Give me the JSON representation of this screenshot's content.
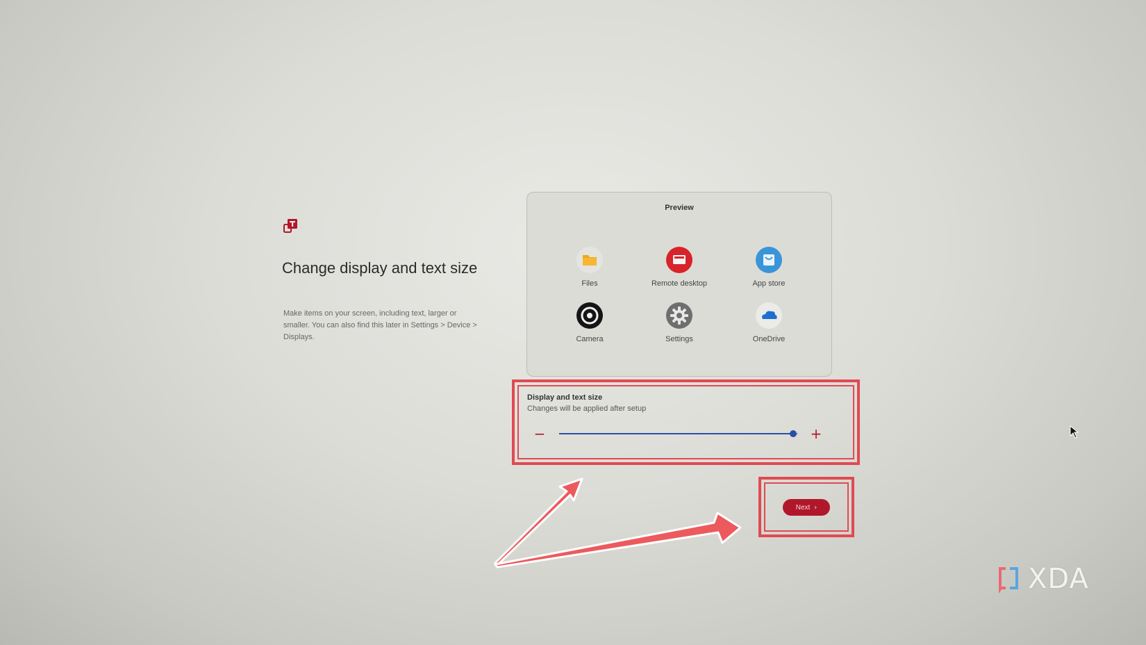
{
  "setup": {
    "heading": "Change display and text size",
    "description": "Make items on your screen, including text, larger or smaller. You can also find this later in Settings > Device > Displays."
  },
  "preview": {
    "title": "Preview",
    "apps": [
      {
        "label": "Files",
        "icon": "folder-icon"
      },
      {
        "label": "Remote desktop",
        "icon": "remote-desktop-icon"
      },
      {
        "label": "App store",
        "icon": "app-store-icon"
      },
      {
        "label": "Camera",
        "icon": "camera-icon"
      },
      {
        "label": "Settings",
        "icon": "gear-icon"
      },
      {
        "label": "OneDrive",
        "icon": "cloud-icon"
      }
    ]
  },
  "display_size": {
    "title": "Display and text size",
    "subtitle": "Changes will be applied after setup",
    "minus_label": "−",
    "plus_label": "+",
    "slider_value_fraction": 0.98
  },
  "footer": {
    "next_label": "Next",
    "next_icon": "chevron-right-icon"
  },
  "watermark": {
    "text": "XDA"
  },
  "colors": {
    "accent": "#b0172a",
    "highlight": "#e04a52",
    "slider": "#2a4fa8"
  }
}
